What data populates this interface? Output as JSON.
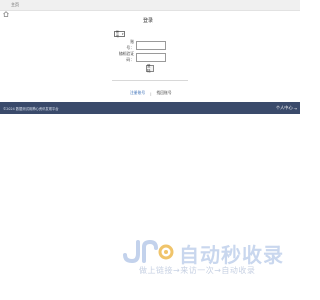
{
  "topbar": {
    "home_label": "主页",
    "home_icon": "home-icon"
  },
  "login": {
    "title": "登录",
    "select_value": "账号",
    "account_label": "账号：",
    "code_label": "随机验证码：",
    "submit_label": "登陆",
    "register_link": "注册账号",
    "separator": "|",
    "retrieve_link": "找回账号"
  },
  "footer": {
    "copyright": "©2024 数据测试用腾心资讯发现平台",
    "user_center": "个人中心",
    "user_center_arrow": "→"
  },
  "watermark": {
    "title": "自动秒收录",
    "subtitle": "做上链接→来访一次→自动收录",
    "logo_text": "JR"
  },
  "colors": {
    "footer_bg": "#3a4a6b",
    "link_blue": "#3a6fb7",
    "watermark": "#c9d7ee"
  }
}
